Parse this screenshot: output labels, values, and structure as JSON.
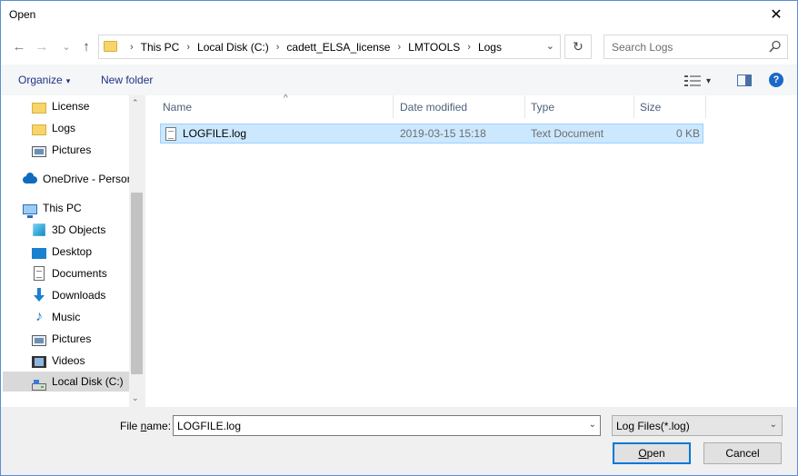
{
  "window": {
    "title": "Open",
    "close_glyph": "✕"
  },
  "nav": {
    "back_glyph": "←",
    "forward_glyph": "→",
    "recent_glyph": "⌄",
    "up_glyph": "↑",
    "breadcrumbs": [
      "This PC",
      "Local Disk (C:)",
      "cadett_ELSA_license",
      "LMTOOLS",
      "Logs"
    ],
    "crumb_sep": "›",
    "dropdown_glyph": "⌄",
    "refresh_glyph": "↻",
    "search_placeholder": "Search Logs"
  },
  "toolbar": {
    "organize_label": "Organize",
    "organize_caret": "▾",
    "new_folder_label": "New folder",
    "view_caret": "▾",
    "help_label": "?"
  },
  "sidebar": {
    "items": [
      {
        "label": "License",
        "icon": "folder-icon"
      },
      {
        "label": "Logs",
        "icon": "folder-icon"
      },
      {
        "label": "Pictures",
        "icon": "pictures-icon"
      },
      {
        "label": "OneDrive - Persor",
        "icon": "onedrive-icon"
      },
      {
        "label": "This PC",
        "icon": "this-pc-icon"
      },
      {
        "label": "3D Objects",
        "icon": "3d-objects-icon"
      },
      {
        "label": "Desktop",
        "icon": "desktop-icon"
      },
      {
        "label": "Documents",
        "icon": "documents-icon"
      },
      {
        "label": "Downloads",
        "icon": "downloads-icon"
      },
      {
        "label": "Music",
        "icon": "music-icon"
      },
      {
        "label": "Pictures",
        "icon": "pictures-icon"
      },
      {
        "label": "Videos",
        "icon": "videos-icon"
      },
      {
        "label": "Local Disk (C:)",
        "icon": "local-disk-icon"
      }
    ],
    "music_glyph": "♪",
    "scroll_up_glyph": "⌃",
    "scroll_down_glyph": "⌄"
  },
  "filelist": {
    "sort_caret": "^",
    "columns": [
      "Name",
      "Date modified",
      "Type",
      "Size"
    ],
    "rows": [
      {
        "name": "LOGFILE.log",
        "date": "2019-03-15 15:18",
        "type": "Text Document",
        "size": "0 KB"
      }
    ]
  },
  "bottom": {
    "file_name_label_pre": "File ",
    "file_name_label_accel": "n",
    "file_name_label_post": "ame:",
    "file_name_value": "LOGFILE.log",
    "dropdown_glyph": "⌄",
    "filter_value": "Log Files(*.log)",
    "open_label_accel": "O",
    "open_label_rest": "pen",
    "cancel_label": "Cancel"
  },
  "colors": {
    "accent": "#0078d7",
    "selection_bg": "#cce8ff",
    "selection_border": "#99d1ff",
    "link_text": "#1e3287",
    "folder": "#f7d46c"
  }
}
